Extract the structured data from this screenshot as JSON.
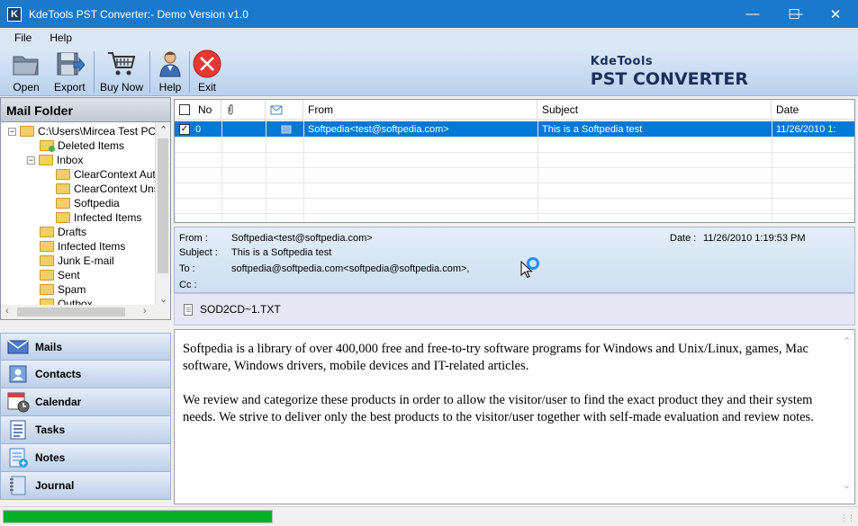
{
  "window": {
    "title": "KdeTools PST Converter:- Demo Version v1.0",
    "app_icon_letter": "K",
    "controls": {
      "minimize": "—",
      "maximize": "☐",
      "close": "✕"
    }
  },
  "menu": {
    "items": [
      "File",
      "Help"
    ]
  },
  "toolbar": {
    "buttons": [
      {
        "label": "Open",
        "icon": "open-folder-icon"
      },
      {
        "label": "Export",
        "icon": "export-disk-icon"
      },
      {
        "label": "Buy Now",
        "icon": "shopping-cart-icon"
      },
      {
        "label": "Help",
        "icon": "help-person-icon"
      },
      {
        "label": "Exit",
        "icon": "exit-x-icon"
      }
    ],
    "brand_small": "KdeTools",
    "brand_big": "PST CONVERTER"
  },
  "mail_folder": {
    "header": "Mail Folder",
    "tree": [
      {
        "label": "C:\\Users\\Mircea Test PC\\",
        "expander": "−"
      },
      {
        "label": "Deleted Items"
      },
      {
        "label": "Inbox",
        "expander": "−"
      },
      {
        "label": "ClearContext Autof"
      },
      {
        "label": "ClearContext Unsu"
      },
      {
        "label": "Softpedia"
      },
      {
        "label": "Infected Items"
      },
      {
        "label": "Drafts"
      },
      {
        "label": "Infected Items"
      },
      {
        "label": "Junk E-mail"
      },
      {
        "label": "Sent"
      },
      {
        "label": "Spam"
      },
      {
        "label": "Outbox"
      }
    ]
  },
  "nav": {
    "items": [
      {
        "label": "Mails",
        "icon": "mails-icon"
      },
      {
        "label": "Contacts",
        "icon": "contacts-icon"
      },
      {
        "label": "Calendar",
        "icon": "calendar-icon"
      },
      {
        "label": "Tasks",
        "icon": "tasks-icon"
      },
      {
        "label": "Notes",
        "icon": "notes-icon"
      },
      {
        "label": "Journal",
        "icon": "journal-icon"
      }
    ]
  },
  "message_list": {
    "columns": {
      "no": "No",
      "attachment": "attachment-icon",
      "read": "envelope-icon",
      "from": "From",
      "subject": "Subject",
      "date": "Date"
    },
    "rows": [
      {
        "checked": true,
        "no": "0",
        "from": "Softpedia<test@softpedia.com>",
        "subject": "This is a Softpedia test",
        "date": "11/26/2010 1:"
      }
    ]
  },
  "preview": {
    "from_label": "From :",
    "from": "Softpedia<test@softpedia.com>",
    "subject_label": "Subject :",
    "subject": "This is a Softpedia test",
    "to_label": "To :",
    "to": "softpedia@softpedia.com<softpedia@softpedia.com>,",
    "cc_label": "Cc :",
    "cc": "",
    "date_label": "Date :",
    "date": "11/26/2010 1:19:53 PM",
    "attachment": "SOD2CD~1.TXT",
    "body": [
      "Softpedia is a library of over 400,000 free and free-to-try software programs for Windows and Unix/Linux, games, Mac software, Windows drivers, mobile devices and IT-related articles.",
      "We review and categorize these products in order to allow the visitor/user to find the exact product they and their system needs. We strive to deliver only the best products to the visitor/user together with self-made evaluation and review notes."
    ]
  },
  "status": {
    "progress": 1.0
  },
  "colors": {
    "titlebar": "#1979ca",
    "selection": "#0078d7",
    "progress": "#06b025"
  }
}
